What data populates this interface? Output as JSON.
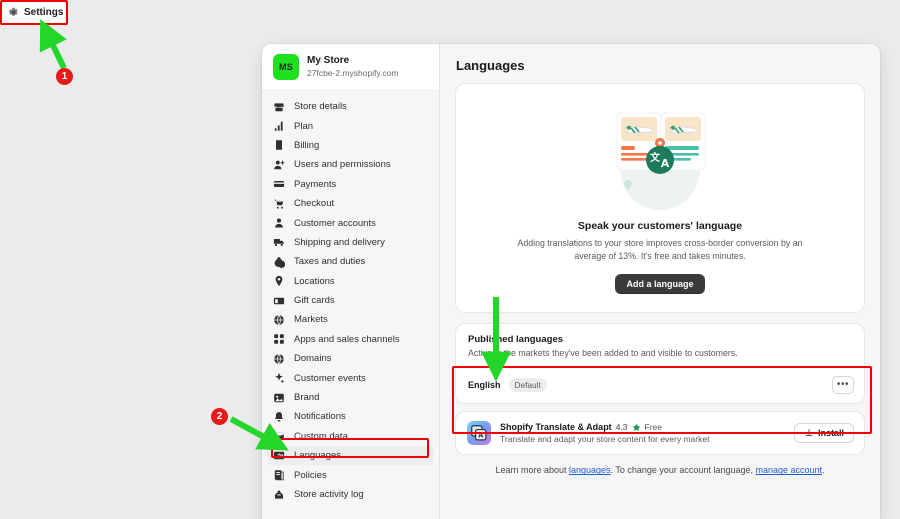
{
  "topbar": {
    "settings_label": "Settings",
    "settings_icon": "gear-icon"
  },
  "store": {
    "initials": "MS",
    "name": "My Store",
    "url": "27fcbe-2.myshopify.com",
    "avatar_color": "#1fe01f"
  },
  "sidebar": {
    "items": [
      {
        "label": "Store details",
        "icon": "store-icon",
        "active": false
      },
      {
        "label": "Plan",
        "icon": "chart-bar-icon",
        "active": false
      },
      {
        "label": "Billing",
        "icon": "bill-icon",
        "active": false
      },
      {
        "label": "Users and permissions",
        "icon": "user-plus-icon",
        "active": false
      },
      {
        "label": "Payments",
        "icon": "credit-card-icon",
        "active": false
      },
      {
        "label": "Checkout",
        "icon": "cart-icon",
        "active": false
      },
      {
        "label": "Customer accounts",
        "icon": "person-icon",
        "active": false
      },
      {
        "label": "Shipping and delivery",
        "icon": "truck-icon",
        "active": false
      },
      {
        "label": "Taxes and duties",
        "icon": "tax-icon",
        "active": false
      },
      {
        "label": "Locations",
        "icon": "pin-icon",
        "active": false
      },
      {
        "label": "Gift cards",
        "icon": "gift-card-icon",
        "active": false
      },
      {
        "label": "Markets",
        "icon": "globe-icon",
        "active": false
      },
      {
        "label": "Apps and sales channels",
        "icon": "apps-grid-icon",
        "active": false
      },
      {
        "label": "Domains",
        "icon": "globe-icon",
        "active": false
      },
      {
        "label": "Customer events",
        "icon": "sparkle-icon",
        "active": false
      },
      {
        "label": "Brand",
        "icon": "brand-icon",
        "active": false
      },
      {
        "label": "Notifications",
        "icon": "bell-icon",
        "active": false
      },
      {
        "label": "Custom data",
        "icon": "database-icon",
        "active": false
      },
      {
        "label": "Languages",
        "icon": "languages-icon",
        "active": true
      },
      {
        "label": "Policies",
        "icon": "policies-icon",
        "active": false
      },
      {
        "label": "Store activity log",
        "icon": "activity-icon",
        "active": false
      }
    ]
  },
  "page": {
    "title": "Languages"
  },
  "hero": {
    "illustration": "translation-illustration",
    "title": "Speak your customers' language",
    "subtitle": "Adding translations to your store improves cross-border conversion by an average of 13%. It's free and takes minutes.",
    "cta_label": "Add a language"
  },
  "published": {
    "title": "Published languages",
    "description": "Active in the markets they've been added to and visible to customers.",
    "rows": [
      {
        "name": "English",
        "badge": "Default",
        "menu_icon": "ellipsis-icon"
      }
    ]
  },
  "app": {
    "icon": "translate-adapt-app-icon",
    "name": "Shopify Translate & Adapt",
    "rating": "4.3",
    "star_icon": "star-icon",
    "price": "Free",
    "description": "Translate and adapt your store content for every market",
    "install_label": "Install",
    "install_icon": "download-icon"
  },
  "footer": {
    "text_before": "Learn more about ",
    "link1": "languages",
    "text_middle": ". To change your account language, ",
    "link2": "manage account",
    "text_after": "."
  },
  "annotations": {
    "markers": [
      {
        "number": "1",
        "target": "settings-button"
      },
      {
        "number": "2",
        "target": "sidebar-item-languages"
      }
    ],
    "highlight_color": "#ef0000",
    "arrow_color": "#24d62a"
  }
}
